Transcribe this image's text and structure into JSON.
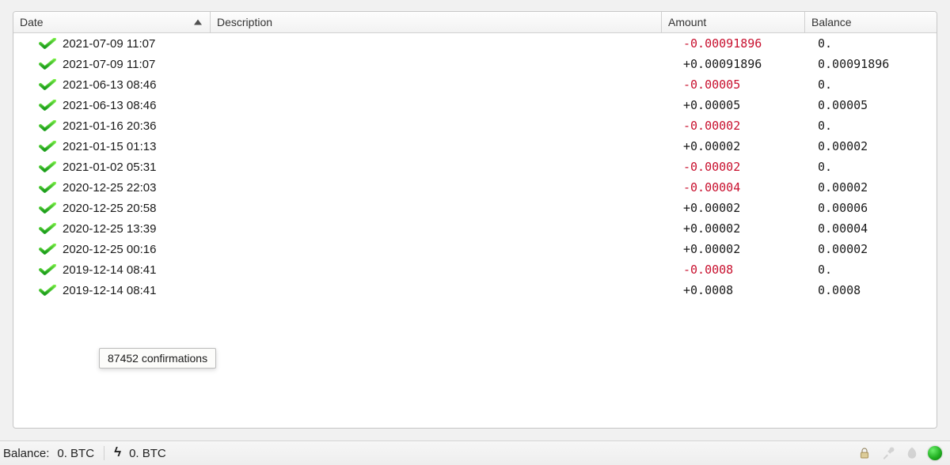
{
  "columns": {
    "date": "Date",
    "description": "Description",
    "amount": "Amount",
    "balance": "Balance",
    "sorted": "date",
    "sort_dir": "asc"
  },
  "transactions": [
    {
      "date": "2021-07-09 11:07",
      "description": "",
      "amount": "-0.00091896",
      "amount_sign": "neg",
      "balance": "0."
    },
    {
      "date": "2021-07-09 11:07",
      "description": "",
      "amount": "+0.00091896",
      "amount_sign": "pos",
      "balance": "0.00091896"
    },
    {
      "date": "2021-06-13 08:46",
      "description": "",
      "amount": "-0.00005",
      "amount_sign": "neg",
      "balance": "0."
    },
    {
      "date": "2021-06-13 08:46",
      "description": "",
      "amount": "+0.00005",
      "amount_sign": "pos",
      "balance": "0.00005"
    },
    {
      "date": "2021-01-16 20:36",
      "description": "",
      "amount": "-0.00002",
      "amount_sign": "neg",
      "balance": "0."
    },
    {
      "date": "2021-01-15 01:13",
      "description": "",
      "amount": "+0.00002",
      "amount_sign": "pos",
      "balance": "0.00002"
    },
    {
      "date": "2021-01-02 05:31",
      "description": "",
      "amount": "-0.00002",
      "amount_sign": "neg",
      "balance": "0."
    },
    {
      "date": "2020-12-25 22:03",
      "description": "",
      "amount": "-0.00004",
      "amount_sign": "neg",
      "balance": "0.00002"
    },
    {
      "date": "2020-12-25 20:58",
      "description": "",
      "amount": "+0.00002",
      "amount_sign": "pos",
      "balance": "0.00006"
    },
    {
      "date": "2020-12-25 13:39",
      "description": "",
      "amount": "+0.00002",
      "amount_sign": "pos",
      "balance": "0.00004"
    },
    {
      "date": "2020-12-25 00:16",
      "description": "",
      "amount": "+0.00002",
      "amount_sign": "pos",
      "balance": "0.00002"
    },
    {
      "date": "2019-12-14 08:41",
      "description": "",
      "amount": "-0.0008",
      "amount_sign": "neg",
      "balance": "0."
    },
    {
      "date": "2019-12-14 08:41",
      "description": "",
      "amount": "+0.0008",
      "amount_sign": "pos",
      "balance": "0.0008"
    }
  ],
  "tooltip": "87452 confirmations",
  "statusbar": {
    "balance_label": "Balance:",
    "balance_value": "0. BTC",
    "lightning_value": "0. BTC"
  },
  "icons": {
    "confirmed": "check-icon",
    "lightning": "bolt-icon",
    "lock": "lock-icon",
    "tools": "tools-icon",
    "seed": "seed-icon",
    "network": "network-status-icon"
  }
}
